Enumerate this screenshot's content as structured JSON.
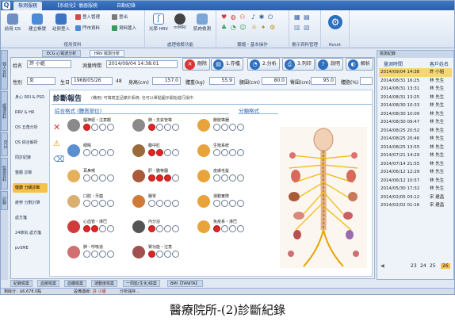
{
  "titlebar": {
    "tabs": [
      "檢測服務",
      "【系統化】儀器服務",
      "自動紀錄"
    ]
  },
  "ribbon": {
    "groups": [
      {
        "label": "使用資料",
        "buttons": [
          "前用 QS",
          "建立帳號",
          "註冊登入"
        ],
        "small": [
          "登入管理",
          "門市資料",
          "登出",
          "資料匯入"
        ]
      },
      {
        "label": "處理檢驗功能",
        "buttons": [
          "光學 HRV",
          "mMRI",
          "肌肉檢測"
        ]
      },
      {
        "label": "聽譜・基本操作",
        "icons": [
          "heart-icon",
          "lungs-icon",
          "user-icon",
          "music-icon",
          "bluetooth-icon",
          "power-icon"
        ]
      },
      {
        "label": "書示資料管理",
        "icons": [
          "grid-icon"
        ]
      },
      {
        "label": "Reset",
        "buttons": [
          "Reset"
        ]
      }
    ]
  },
  "left_tabs": [
    "個人資料",
    "處理資料",
    "ECG",
    "監測資料",
    "記錄"
  ],
  "doc_tabs": [
    "ECG 心電波分析",
    "HRV 檢測分析"
  ],
  "patient": {
    "name_label": "姓名",
    "name_value": "許 小姐",
    "measure_time_label": "測量時間",
    "measure_time_value": "2014/09/04 14:38:01",
    "gender_label": "性別",
    "gender_value": "女",
    "birth_label": "生日",
    "birth_value": "1968/05/26",
    "age_value": "48",
    "height_label": "身高(cm)",
    "height_value": "157.0",
    "weight_label": "體重(kg)",
    "weight_value": "55.9",
    "waist_label": "腰圍(cm)",
    "waist_value": "80.0",
    "hip_label": "臀圍(cm)",
    "hip_value": "95.0",
    "fat_label": "體脂(%)"
  },
  "toolbar": {
    "delete": "刪除",
    "step1": "1.存檔",
    "step2": "2.分析",
    "step3": "3.列印",
    "help": "說明",
    "analyze": "解析"
  },
  "side_menu": [
    "身心 RRI & PSD",
    "RRV & HR",
    "QS 五角分析",
    "QS 綜合解析",
    "問診紀錄",
    "整體 診斷",
    "健康 分級診斷",
    "疲勞 分數計算",
    "處方箋",
    "24節氣 處方箋",
    "pvSME"
  ],
  "active_side_item": 6,
  "report": {
    "title": "診斷報告",
    "note": "(備用) 可填寫並記錄於系統; 也可以單點圖示開始進行操作.",
    "section_left": "綜合格式 (體質部位)",
    "section_right": "分類格式"
  },
  "organs": [
    {
      "name": "腦神經・注意觀",
      "red": 1,
      "icon": "brain-icon"
    },
    {
      "name": "肺・支氣管等",
      "red": 1,
      "icon": "lungs-icon"
    },
    {
      "name": "膀胱等器",
      "red": 0,
      "icon": "bladder-icon"
    },
    {
      "name": "眼睛",
      "red": 0,
      "icon": "eye-icon"
    },
    {
      "name": "腹中肛",
      "red": 2,
      "icon": "stomach-icon"
    },
    {
      "name": "生殖系統",
      "red": 0,
      "icon": "uterus-icon"
    },
    {
      "name": "耳鼻喉",
      "red": 0,
      "icon": "ear-icon"
    },
    {
      "name": "肝・膽等器",
      "red": 3,
      "icon": "liver-icon"
    },
    {
      "name": "皮膚毛髮",
      "red": 0,
      "icon": "skin-icon"
    },
    {
      "name": "口腔・牙齒",
      "red": 0,
      "icon": "tooth-icon"
    },
    {
      "name": "腸胃",
      "red": 0,
      "icon": "intestine-icon"
    },
    {
      "name": "運動實際",
      "red": 0,
      "icon": "bone-icon"
    },
    {
      "name": "心血管・淋巴",
      "red": 2,
      "icon": "heart-icon"
    },
    {
      "name": "內分泌",
      "red": 1,
      "icon": "gland-icon"
    },
    {
      "name": "免疫系・淋巴",
      "red": 1,
      "icon": "immune-icon"
    },
    {
      "name": "肺・呼吸道",
      "red": 0,
      "icon": "lung2-icon"
    },
    {
      "name": "腎功能・注意",
      "red": 1,
      "icon": "kidney-icon"
    }
  ],
  "right_panel": {
    "header": "檢測紀錄",
    "col_time": "量測時間",
    "col_name": "客戶姓名",
    "rows": [
      {
        "time": "2014/09/04 14:38",
        "name": "許 小姐",
        "selected": true
      },
      {
        "time": "2014/08/31 16:25",
        "name": "林 先生"
      },
      {
        "time": "2014/08/31 13:31",
        "name": "林 先生"
      },
      {
        "time": "2014/08/31 13:25",
        "name": "林 先生"
      },
      {
        "time": "2014/08/30 10:33",
        "name": "林 先生"
      },
      {
        "time": "2014/08/30 10:09",
        "name": "林 先生"
      },
      {
        "time": "2014/08/30 09:47",
        "name": "林 先生"
      },
      {
        "time": "2014/08/25 20:52",
        "name": "林 先生"
      },
      {
        "time": "2014/08/25 20:46",
        "name": "林 先生"
      },
      {
        "time": "2014/08/25 13:55",
        "name": "林 先生"
      },
      {
        "time": "2014/07/21 14:29",
        "name": "林 先生"
      },
      {
        "time": "2014/07/14 21:55",
        "name": "林 先生"
      },
      {
        "time": "2014/06/12 12:29",
        "name": "林 先生"
      },
      {
        "time": "2014/06/12 10:57",
        "name": "林 先生"
      },
      {
        "time": "2014/05/30 17:32",
        "name": "林 先生"
      },
      {
        "time": "2014/02/05 03:12",
        "name": "宋 建昌"
      },
      {
        "time": "2014/02/02 01:16",
        "name": "宋 建昌"
      }
    ],
    "pages": [
      "23",
      "24",
      "25",
      "26"
    ]
  },
  "bottom_tabs": [
    "紀錄檢案",
    "血壓檢案",
    "血糖檢案",
    "運動度檢案",
    "一周監(生化)檢案",
    "BMI【TANITA】"
  ],
  "status": {
    "left": "剩餘分：$6,678.0點",
    "login_label": "設備連線：",
    "login_user": "許 小姐",
    "analysis": "分析儲存..."
  },
  "caption": "醫療院所-(2)診斷紀錄"
}
